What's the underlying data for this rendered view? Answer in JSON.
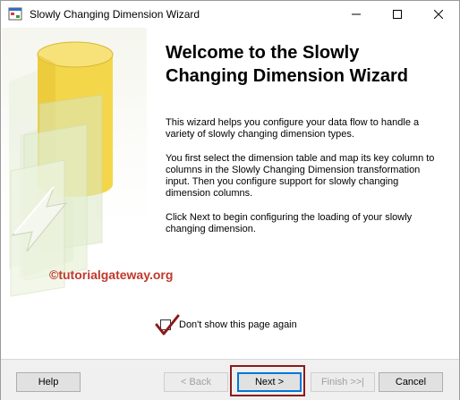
{
  "window": {
    "title": "Slowly Changing Dimension Wizard"
  },
  "titlebar_buttons": {
    "minimize_icon": "minimize-icon",
    "maximize_icon": "maximize-icon",
    "close_icon": "close-icon"
  },
  "content": {
    "heading_line1": "Welcome to the Slowly",
    "heading_line2": "Changing Dimension Wizard",
    "paragraph1": "This wizard helps you configure your data flow to handle a variety of slowly changing dimension types.",
    "paragraph2": "You first select the dimension table and map its key column to columns in the Slowly Changing Dimension transformation input. Then you configure support for slowly changing dimension columns.",
    "paragraph3": "Click Next to begin configuring the loading of your slowly changing dimension."
  },
  "watermark": "©tutorialgateway.org",
  "checkbox": {
    "label": "Don't show this page again",
    "checked": false
  },
  "buttons": {
    "help": "Help",
    "back": "< Back",
    "next": "Next >",
    "finish": "Finish >>|",
    "cancel": "Cancel"
  },
  "colors": {
    "cylinder": "#f3d64a",
    "annotation": "#8b1a1a",
    "watermark": "#c0392b"
  }
}
